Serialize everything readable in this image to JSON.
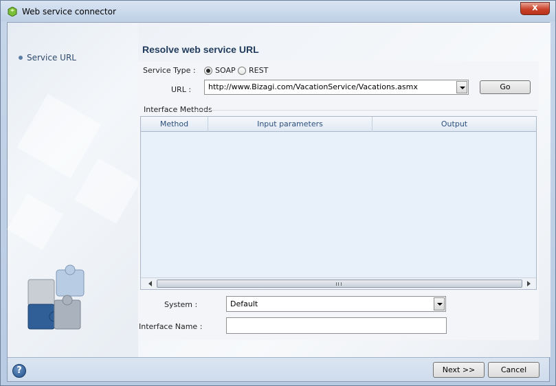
{
  "window": {
    "title": "Web service connector",
    "close_label": "x"
  },
  "sidebar": {
    "items": [
      {
        "label": "Service URL"
      }
    ]
  },
  "main": {
    "heading": "Resolve web service URL",
    "service_type": {
      "label": "Service Type :",
      "options": [
        {
          "label": "SOAP",
          "selected": true
        },
        {
          "label": "REST",
          "selected": false
        }
      ]
    },
    "url": {
      "label": "URL :",
      "value": "http://www.Bizagi.com/VacationService/Vacations.asmx"
    },
    "go_label": "Go",
    "interface_methods": {
      "title": "Interface Methods",
      "columns": [
        "Method",
        "Input parameters",
        "Output"
      ],
      "rows": []
    },
    "system": {
      "label": "System :",
      "value": "Default"
    },
    "interface_name": {
      "label": "Interface Name :",
      "value": ""
    }
  },
  "footer": {
    "help_label": "?",
    "next_label": "Next >>",
    "cancel_label": "Cancel"
  },
  "colors": {
    "heading": "#1f3a5c",
    "grid_bg": "#e8f0f9",
    "close": "#c9432b"
  },
  "icons": [
    "app-icon",
    "close-icon",
    "bullet-icon",
    "puzzle-icon",
    "help-icon",
    "dropdown-arrow-icon",
    "scroll-left-icon",
    "scroll-right-icon"
  ]
}
